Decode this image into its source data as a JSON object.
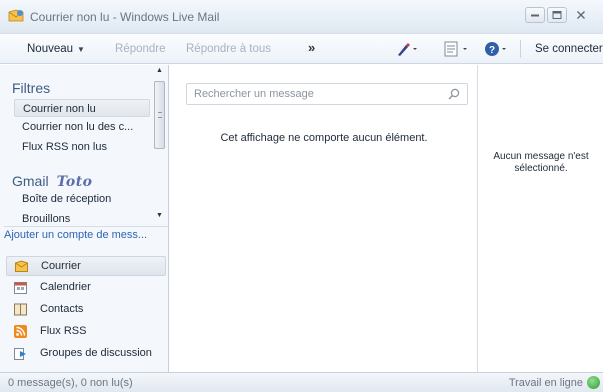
{
  "window": {
    "title": "Courrier non lu - Windows Live Mail"
  },
  "toolbar": {
    "new_label": "Nouveau",
    "reply_label": "Répondre",
    "reply_all_label": "Répondre à tous",
    "more_label": "»",
    "connect_label": "Se connecter",
    "icons": [
      "pen-icon",
      "view-icon",
      "help-icon"
    ]
  },
  "sidebar": {
    "filters_heading": "Filtres",
    "filters": [
      {
        "label": "Courrier non lu",
        "selected": true
      },
      {
        "label": "Courrier non lu des c..."
      },
      {
        "label": "Flux RSS non lus"
      }
    ],
    "account_heading": "Gmail",
    "account_name": "Toto",
    "account_folders": [
      {
        "label": "Boîte de réception"
      },
      {
        "label": "Brouillons"
      }
    ],
    "add_account_label": "Ajouter un compte de mess..."
  },
  "nav": {
    "items": [
      {
        "label": "Courrier",
        "icon": "mail-icon",
        "selected": true
      },
      {
        "label": "Calendrier",
        "icon": "calendar-icon"
      },
      {
        "label": "Contacts",
        "icon": "contacts-icon"
      },
      {
        "label": "Flux RSS",
        "icon": "rss-icon"
      },
      {
        "label": "Groupes de discussion",
        "icon": "newsgroup-icon"
      }
    ]
  },
  "message_list": {
    "search_placeholder": "Rechercher un message",
    "empty_text": "Cet affichage ne comporte aucun élément."
  },
  "reading_pane": {
    "empty_text": "Aucun message n'est sélectionné."
  },
  "statusbar": {
    "count_text": "0 message(s), 0 non lu(s)",
    "online_text": "Travail en ligne"
  },
  "colors": {
    "accent": "#3f5c86",
    "link": "#2d66b4",
    "online": "#2f9a3a"
  }
}
